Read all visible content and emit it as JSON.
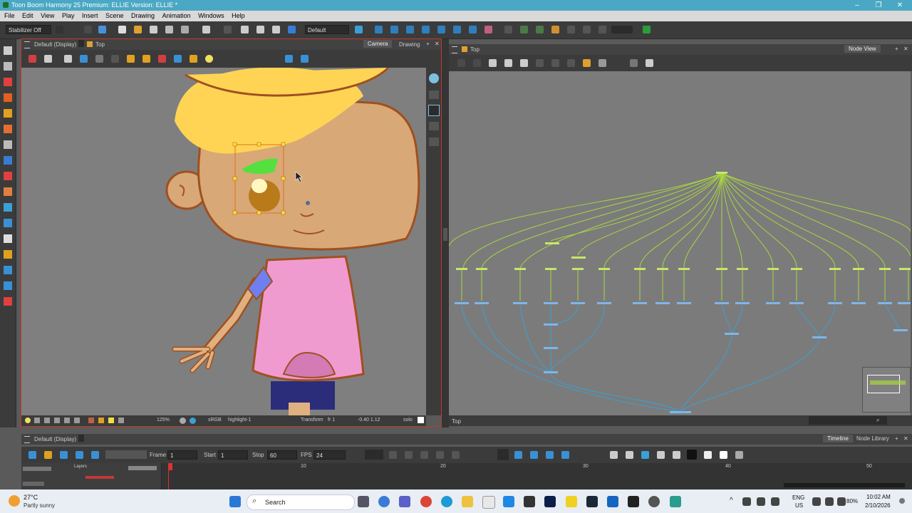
{
  "window": {
    "title": "Toon Boom Harmony 25 Premium: ELLIE Version: ELLIE *"
  },
  "menu": [
    "File",
    "Edit",
    "View",
    "Play",
    "Insert",
    "Scene",
    "Drawing",
    "Animation",
    "Windows",
    "Help"
  ],
  "toolbar": {
    "stabilizer": "Stabilizer Off",
    "workspace": "Default"
  },
  "camera_panel": {
    "title": "Default (Display)",
    "view_label": "Top",
    "tab_camera": "Camera",
    "tab_drawing": "Drawing",
    "status": {
      "zoom": "125%",
      "color_space": "sRGB",
      "layer": "highlight-1",
      "tool": "Transform",
      "frame": "fr 1",
      "coords": "-0.40 1.12",
      "mode": "solo"
    }
  },
  "node_panel": {
    "title": "Top",
    "tab": "Node View",
    "footer": "Top"
  },
  "timeline": {
    "title": "Default (Display)",
    "tab_timeline": "Timeline",
    "tab_library": "Node Library",
    "frame_label": "Frame",
    "frame_value": "1",
    "start_label": "Start",
    "start_value": "1",
    "stop_label": "Stop",
    "stop_value": "60",
    "fps_label": "FPS",
    "fps_value": "24",
    "layers_label": "Layers",
    "ruler": [
      "10",
      "20",
      "30",
      "40",
      "50"
    ]
  },
  "taskbar": {
    "weather_temp": "27°C",
    "weather_desc": "Partly sunny",
    "search": "Search",
    "lang": "ENG",
    "region": "US",
    "battery": "80%",
    "time": "10:02 AM",
    "date": "2/10/2026"
  },
  "colors": {
    "accent_red": "#c0392b",
    "node_green": "#c7e66a",
    "node_blue": "#7fb6e8",
    "titlebar": "#4aa8c4"
  }
}
